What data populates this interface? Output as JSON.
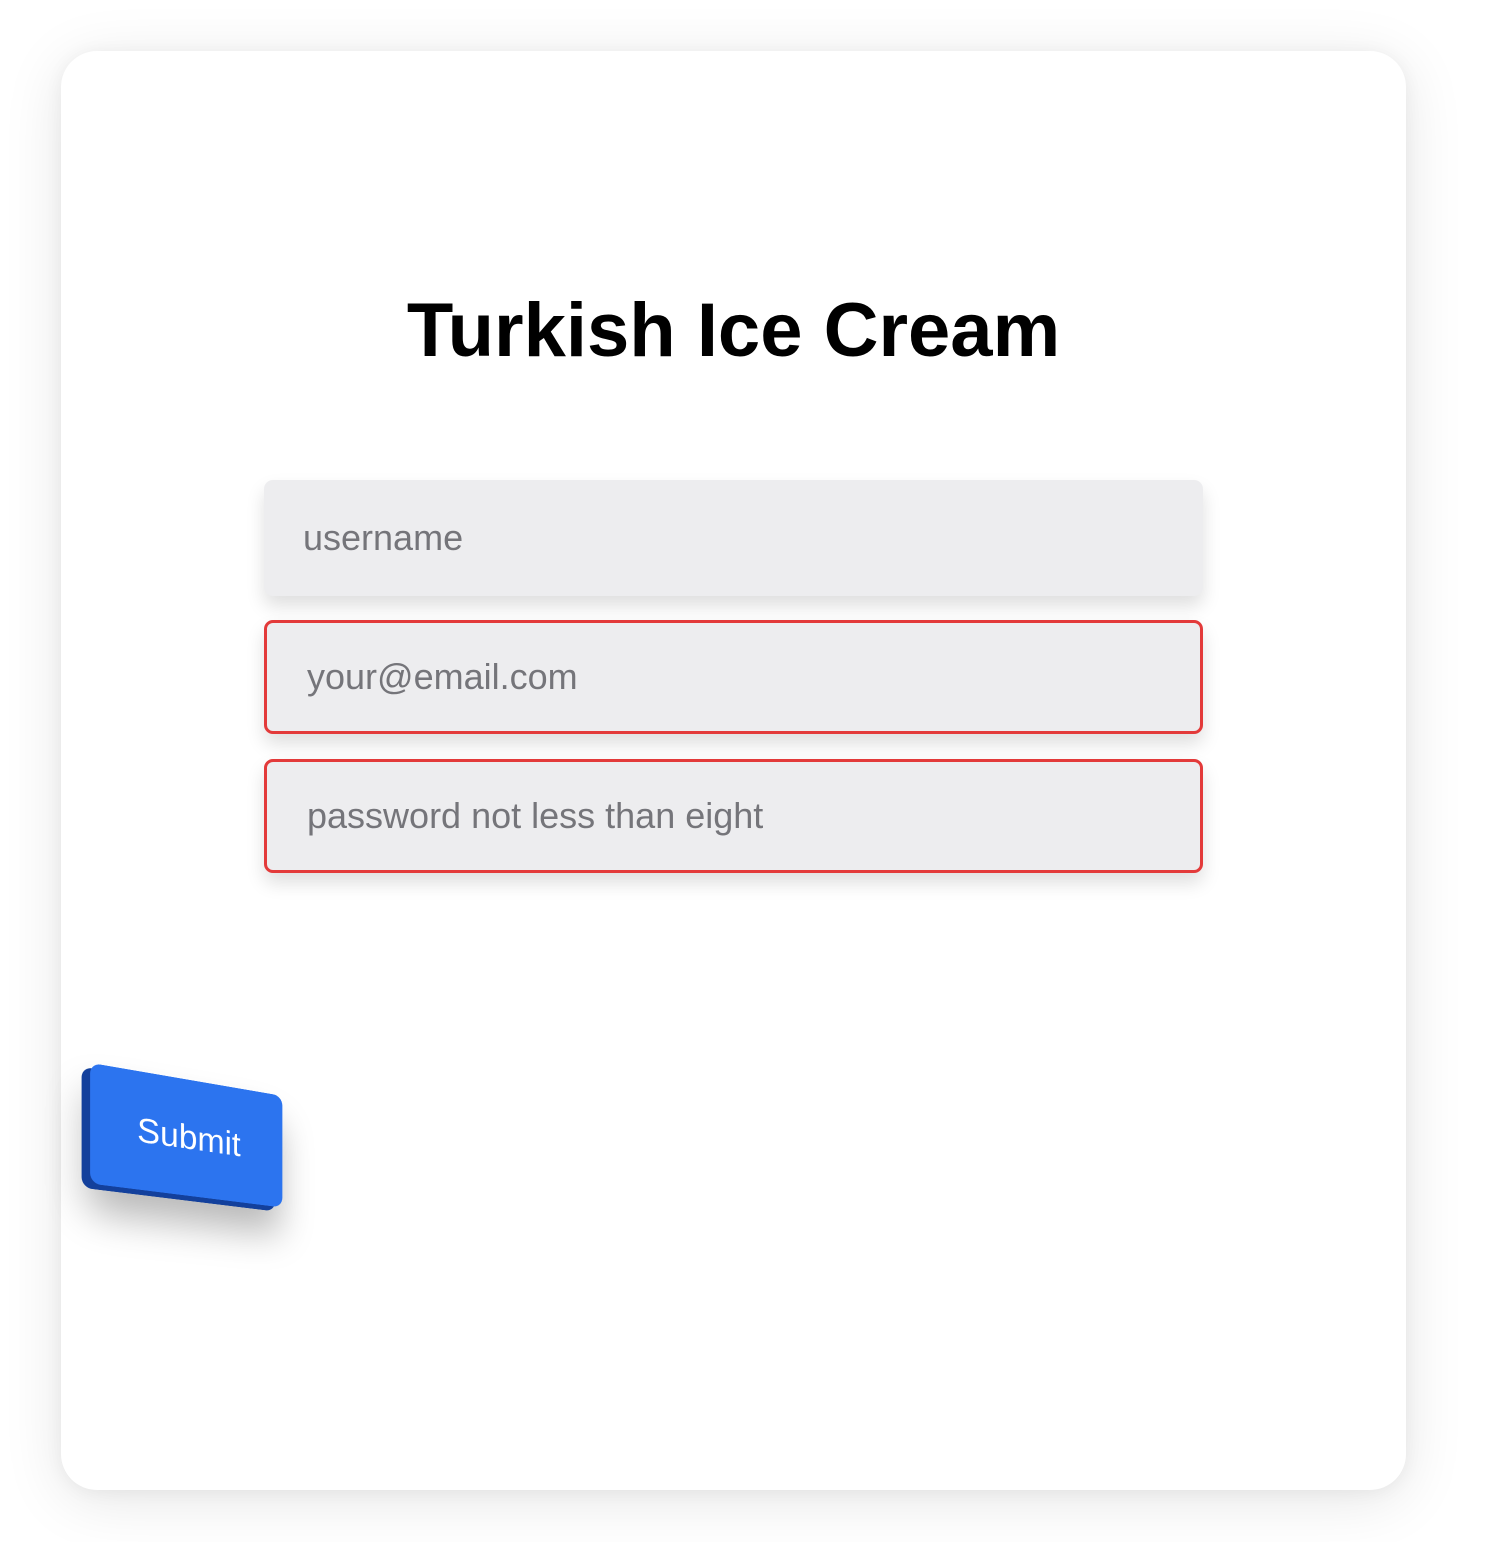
{
  "form": {
    "title": "Turkish Ice Cream",
    "username_placeholder": "username",
    "email_placeholder": "your@email.com",
    "password_placeholder": "password not less than eight",
    "submit_label": "Submit"
  },
  "colors": {
    "error_border": "#e33a3a",
    "button": "#2c74ef",
    "field_background": "#ededef"
  }
}
